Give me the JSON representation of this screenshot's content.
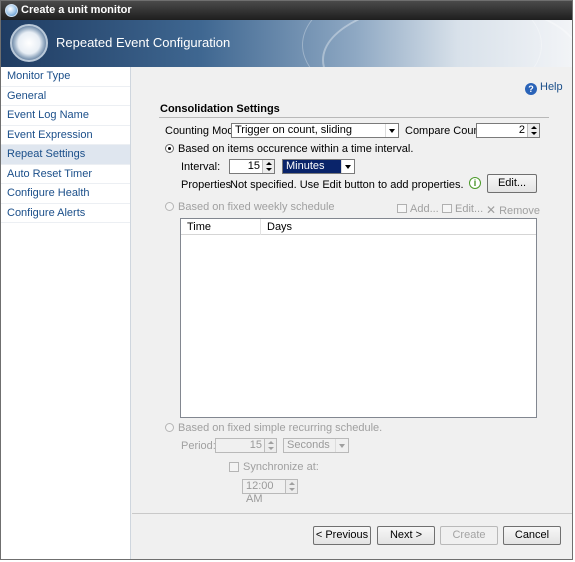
{
  "window": {
    "title": "Create a unit monitor"
  },
  "banner": {
    "title": "Repeated Event Configuration"
  },
  "sidebar": {
    "items": [
      {
        "label": "Monitor Type"
      },
      {
        "label": "General"
      },
      {
        "label": "Event Log Name"
      },
      {
        "label": "Event Expression"
      },
      {
        "label": "Repeat Settings",
        "active": true
      },
      {
        "label": "Auto Reset Timer"
      },
      {
        "label": "Configure Health"
      },
      {
        "label": "Configure Alerts"
      }
    ]
  },
  "help": {
    "label": "Help"
  },
  "consolidation": {
    "title": "Consolidation Settings",
    "counting_mode_label": "Counting Mode:",
    "counting_mode_value": "Trigger on count, sliding",
    "compare_count_label": "Compare Count:",
    "compare_count_value": "2",
    "radio_time_interval": "Based on items occurence within a time interval.",
    "interval_label": "Interval:",
    "interval_value": "15",
    "interval_unit": "Minutes",
    "properties_label": "Properties",
    "properties_text": "Not specified.  Use Edit button to add properties.",
    "info_icon_glyph": "i",
    "edit_button": "Edit...",
    "radio_weekly": "Based on fixed weekly schedule",
    "toolbar": {
      "add": "Add...",
      "edit": "Edit...",
      "remove": "Remove"
    },
    "table": {
      "columns": [
        "Time",
        "Days"
      ],
      "rows": []
    },
    "radio_simple": "Based on fixed simple recurring schedule.",
    "period_label": "Period:",
    "period_value": "15",
    "period_unit": "Seconds",
    "synchronize_label": "Synchronize at:",
    "synchronize_value": "12:00 AM"
  },
  "footer": {
    "previous": "< Previous",
    "next": "Next >",
    "create": "Create",
    "cancel": "Cancel"
  },
  "icons": {
    "window_icon": "orb-icon",
    "help_icon": "question-icon",
    "info_icon": "info-icon",
    "remove_icon": "x-icon"
  },
  "colors": {
    "link": "#1b4f8a",
    "selection": "#0a246a",
    "info": "#3c8c1c"
  }
}
